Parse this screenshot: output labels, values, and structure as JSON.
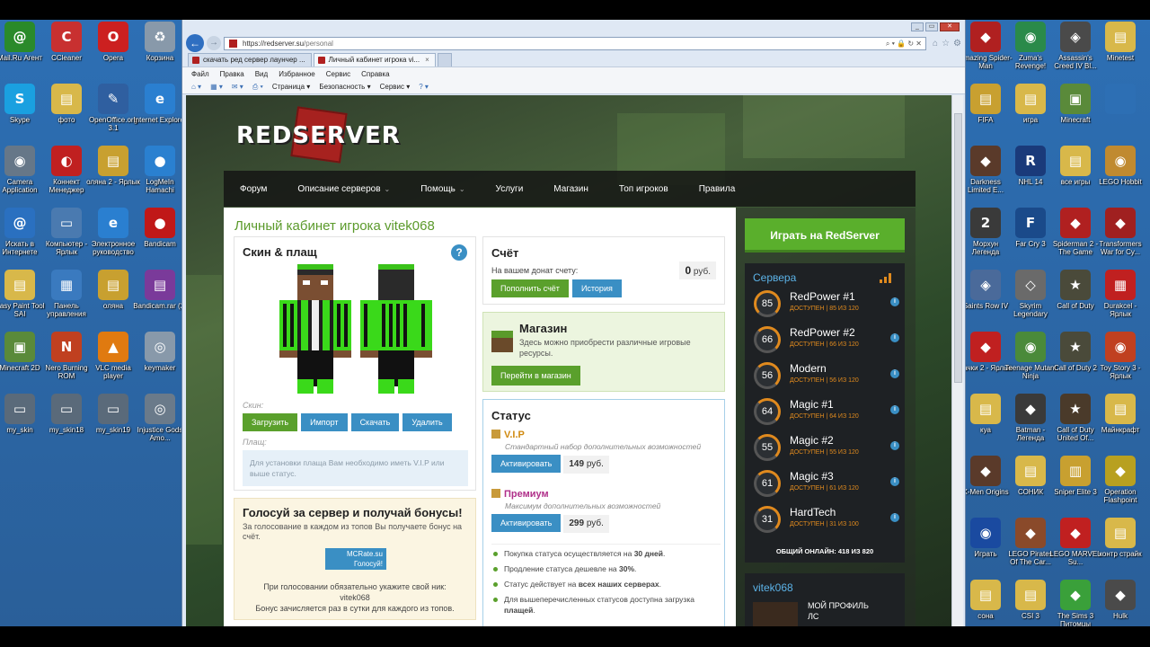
{
  "desktop": {
    "left_icons": [
      {
        "label": "Mail.Ru Агент",
        "glyph": "@",
        "color": "#2a8a2a"
      },
      {
        "label": "CCleaner",
        "glyph": "C",
        "color": "#c83030"
      },
      {
        "label": "Opera",
        "glyph": "O",
        "color": "#cc2020"
      },
      {
        "label": "Корзина",
        "glyph": "♻",
        "color": "#8899aa"
      },
      {
        "label": "Skype",
        "glyph": "S",
        "color": "#1aa0e0"
      },
      {
        "label": "фото",
        "glyph": "▤",
        "color": "#d8b84a"
      },
      {
        "label": "OpenOffice.org 3.1",
        "glyph": "✎",
        "color": "#2f5fa0"
      },
      {
        "label": "Internet Explorer",
        "glyph": "e",
        "color": "#2a7fd0"
      },
      {
        "label": "Camera Application",
        "glyph": "◉",
        "color": "#667788"
      },
      {
        "label": "Коннект Менеджер",
        "glyph": "◐",
        "color": "#c02020"
      },
      {
        "label": "оляна 2 - Ярлык",
        "glyph": "▤",
        "color": "#c8a030"
      },
      {
        "label": "LogMeIn Hamachi",
        "glyph": "●",
        "color": "#2a80d0"
      },
      {
        "label": "Искать в Интернете",
        "glyph": "@",
        "color": "#2a70c0"
      },
      {
        "label": "Компьютер - Ярлык",
        "glyph": "▭",
        "color": "#4a7ab0"
      },
      {
        "label": "Электронное руководство",
        "glyph": "e",
        "color": "#2a7fd0"
      },
      {
        "label": "Bandicam",
        "glyph": "●",
        "color": "#c01818"
      },
      {
        "label": "Easy Paint Tool SAI",
        "glyph": "▤",
        "color": "#d8b84a"
      },
      {
        "label": "Панель управления",
        "glyph": "▦",
        "color": "#3a7abf"
      },
      {
        "label": "оляна",
        "glyph": "▤",
        "color": "#c8a030"
      },
      {
        "label": "Bandicam.rar (2)",
        "glyph": "▤",
        "color": "#7a3a9a"
      },
      {
        "label": "Minecraft 2D",
        "glyph": "▣",
        "color": "#5a8a3a"
      },
      {
        "label": "Nero Burning ROM",
        "glyph": "N",
        "color": "#c04020"
      },
      {
        "label": "VLC media player",
        "glyph": "▲",
        "color": "#e07a10"
      },
      {
        "label": "keymaker",
        "glyph": "◎",
        "color": "#8899aa"
      },
      {
        "label": "my_skin",
        "glyph": "▭",
        "color": "#5a6a7a"
      },
      {
        "label": "my_skin18",
        "glyph": "▭",
        "color": "#5a6a7a"
      },
      {
        "label": "my_skin19",
        "glyph": "▭",
        "color": "#5a6a7a"
      },
      {
        "label": "Injustice Gods Amo...",
        "glyph": "◎",
        "color": "#6a7a8a"
      }
    ],
    "right_icons": [
      {
        "label": "Amazing Spider-Man",
        "glyph": "◆",
        "color": "#b02020"
      },
      {
        "label": "Zuma's Revenge!",
        "glyph": "◉",
        "color": "#2a8a4a"
      },
      {
        "label": "Assassin's Creed IV Bl...",
        "glyph": "◈",
        "color": "#4a4a4a"
      },
      {
        "label": "Minetest",
        "glyph": "▤",
        "color": "#d8b84a"
      },
      {
        "label": "FIFA",
        "glyph": "▤",
        "color": "#c8a030"
      },
      {
        "label": "игра",
        "glyph": "▤",
        "color": "#d8b84a"
      },
      {
        "label": "Minecraft",
        "glyph": "▣",
        "color": "#5a8a3a"
      },
      {
        "label": "",
        "glyph": "",
        "color": "#2d6fb4"
      },
      {
        "label": "Darkness Limited E...",
        "glyph": "◆",
        "color": "#5a3a2a"
      },
      {
        "label": "NHL 14",
        "glyph": "R",
        "color": "#1a3a7a"
      },
      {
        "label": "все игры",
        "glyph": "▤",
        "color": "#d8b84a"
      },
      {
        "label": "LEGO Hobbit",
        "glyph": "◉",
        "color": "#c08a30"
      },
      {
        "label": "Морхун Легенда",
        "glyph": "2",
        "color": "#3a3a3a"
      },
      {
        "label": "Far Cry 3",
        "glyph": "F",
        "color": "#1a4a8a"
      },
      {
        "label": "Spiderman 2 - The Game",
        "glyph": "◆",
        "color": "#b02020"
      },
      {
        "label": "Transformers War for Cy...",
        "glyph": "◆",
        "color": "#a02020"
      },
      {
        "label": "Saints Row IV",
        "glyph": "◈",
        "color": "#4a6a9a"
      },
      {
        "label": "Skyrim Legendary",
        "glyph": "◇",
        "color": "#6a6a6a"
      },
      {
        "label": "Call of Duty",
        "glyph": "★",
        "color": "#4a4a3a"
      },
      {
        "label": "Durakcel - Ярлык",
        "glyph": "▦",
        "color": "#c02020"
      },
      {
        "label": "Тачки 2 - Ярлык",
        "glyph": "◆",
        "color": "#c02020"
      },
      {
        "label": "Teenage Mutant Ninja",
        "glyph": "◉",
        "color": "#4a8a3a"
      },
      {
        "label": "Call of Duty 2",
        "glyph": "★",
        "color": "#4a4a3a"
      },
      {
        "label": "Toy Story 3 - Ярлык",
        "glyph": "◉",
        "color": "#c04020"
      },
      {
        "label": "куа",
        "glyph": "▤",
        "color": "#d8b84a"
      },
      {
        "label": "Batman - Легенда",
        "glyph": "◆",
        "color": "#3a3a3a"
      },
      {
        "label": "Call of Duty United Of...",
        "glyph": "★",
        "color": "#4a3a2a"
      },
      {
        "label": "Майнкрафт",
        "glyph": "▤",
        "color": "#d8b84a"
      },
      {
        "label": "X-Men Origins",
        "glyph": "◆",
        "color": "#5a3a2a"
      },
      {
        "label": "СОНИК",
        "glyph": "▤",
        "color": "#d8b84a"
      },
      {
        "label": "Sniper Elite 3",
        "glyph": "▥",
        "color": "#c8a030"
      },
      {
        "label": "Operation Flashpoint",
        "glyph": "◆",
        "color": "#b8a020"
      },
      {
        "label": "Играть",
        "glyph": "◉",
        "color": "#1a4aa0"
      },
      {
        "label": "LEGO Pirates Of The Car...",
        "glyph": "◆",
        "color": "#8a4a2a"
      },
      {
        "label": "LEGO MARVEL Su...",
        "glyph": "◆",
        "color": "#c02020"
      },
      {
        "label": "контр страйк",
        "glyph": "▤",
        "color": "#d8b84a"
      },
      {
        "label": "сонa",
        "glyph": "▤",
        "color": "#d8b84a"
      },
      {
        "label": "CSI 3",
        "glyph": "▤",
        "color": "#d8b84a"
      },
      {
        "label": "The Sims 3 Питомцы",
        "glyph": "◆",
        "color": "#3aa03a"
      },
      {
        "label": "Hulk",
        "glyph": "◆",
        "color": "#4a4a4a"
      }
    ]
  },
  "browser": {
    "address": "https://redserver.su/personal",
    "address_host": "https://redserver.su",
    "address_path": "/personal",
    "tabs": [
      {
        "label": "скачать ред сервер лаунчер ...",
        "extra": ""
      },
      {
        "label": "Личный кабинет игрока vi...",
        "extra": "×"
      }
    ],
    "menu": [
      "Файл",
      "Правка",
      "Вид",
      "Избранное",
      "Сервис",
      "Справка"
    ],
    "commands": [
      "Страница ▾",
      "Безопасность ▾",
      "Сервис ▾"
    ]
  },
  "site": {
    "logo": "REDSERVER",
    "nav": [
      {
        "label": "Форум",
        "caret": ""
      },
      {
        "label": "Описание серверов",
        "caret": "⌄"
      },
      {
        "label": "Помощь",
        "caret": "⌄"
      },
      {
        "label": "Услуги",
        "caret": ""
      },
      {
        "label": "Магазин",
        "caret": ""
      },
      {
        "label": "Топ игроков",
        "caret": ""
      },
      {
        "label": "Правила",
        "caret": ""
      }
    ],
    "page_title": "Личный кабинет игрока vitek068",
    "skin": {
      "title": "Скин & плащ",
      "help": "?",
      "skin_label": "Скин:",
      "buttons": [
        "Загрузить",
        "Импорт",
        "Скачать",
        "Удалить"
      ],
      "cloak_label": "Плащ:",
      "cloak_note": "Для установки плаща Вам необходимо иметь V.I.P или выше статус."
    },
    "account": {
      "title": "Счёт",
      "balance_label": "На вашем донат счету:",
      "balance_value": "0",
      "balance_unit": "руб.",
      "topup": "Пополнить счёт",
      "history": "История"
    },
    "shop": {
      "title": "Магазин",
      "text": "Здесь можно приобрести различные игровые ресурсы.",
      "button": "Перейти в магазин"
    },
    "status": {
      "title": "Статус",
      "items": [
        {
          "name": "V.I.P",
          "desc": "Стандартный набор дополнительных возможностей",
          "button": "Активировать",
          "price": "149",
          "unit": "руб."
        },
        {
          "name": "Премиум",
          "desc": "Максимум дополнительных возможностей",
          "button": "Активировать",
          "price": "299",
          "unit": "руб."
        }
      ],
      "bullets": [
        {
          "a": "Покупка статуса осуществляется на ",
          "b": "30 дней",
          "c": "."
        },
        {
          "a": "Продление статуса дешевле на ",
          "b": "30%",
          "c": "."
        },
        {
          "a": "Статус действует на ",
          "b": "всех наших серверах",
          "c": "."
        },
        {
          "a": "Для вышеперечисленных статусов доступна загрузка ",
          "b": "плащей",
          "c": "."
        }
      ]
    },
    "vote": {
      "title": "Голосуй за сервер и получай бонусы!",
      "text": "За голосование в каждом из топов Вы получаете бонус на счёт.",
      "banner_1": "MCRate.su",
      "banner_2": "Голосуй!",
      "nick_note": "При голосовании обязательно укажите свой ник:",
      "nick": "vitek068",
      "bonus_note": "Бонус зачисляется раз в сутки для каждого из топов."
    },
    "sidebar": {
      "play": "Играть на RedServer",
      "servers_title": "Сервера",
      "servers": [
        {
          "name": "RedPower #1",
          "online": 85,
          "max": 120,
          "status": "ДОСТУПЕН | 85 ИЗ 120"
        },
        {
          "name": "RedPower #2",
          "online": 66,
          "max": 120,
          "status": "ДОСТУПЕН | 66 ИЗ 120"
        },
        {
          "name": "Modern",
          "online": 56,
          "max": 120,
          "status": "ДОСТУПЕН | 56 ИЗ 120"
        },
        {
          "name": "Magic #1",
          "online": 64,
          "max": 120,
          "status": "ДОСТУПЕН | 64 ИЗ 120"
        },
        {
          "name": "Magic #2",
          "online": 55,
          "max": 120,
          "status": "ДОСТУПЕН | 55 ИЗ 120"
        },
        {
          "name": "Magic #3",
          "online": 61,
          "max": 120,
          "status": "ДОСТУПЕН | 61 ИЗ 120"
        },
        {
          "name": "HardTech",
          "online": 31,
          "max": 100,
          "status": "ДОСТУПЕН | 31 ИЗ 100"
        }
      ],
      "total_label": "ОБЩИЙ ОНЛАЙН:",
      "total_value": "418 ИЗ 820",
      "username": "vitek068",
      "profile_1": "МОЙ ПРОФИЛЬ",
      "profile_2": "ЛС"
    }
  }
}
